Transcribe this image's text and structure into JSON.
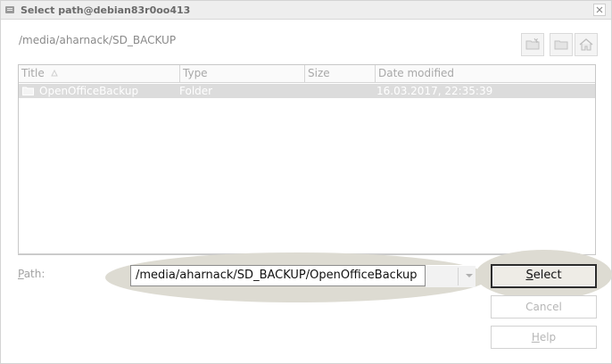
{
  "window": {
    "title": "Select path@debian83r0oo413",
    "current_path": "/media/aharnack/SD_BACKUP"
  },
  "toolbar": {
    "icons": [
      "new-folder-icon",
      "up-folder-icon",
      "home-icon"
    ]
  },
  "filelist": {
    "columns": [
      "Title",
      "Type",
      "Size",
      "Date modified"
    ],
    "rows": [
      {
        "title": "OpenOfficeBackup",
        "type": "Folder",
        "size": "",
        "date_modified": "16.03.2017, 22:35:39",
        "icon": "folder-icon"
      }
    ]
  },
  "path": {
    "label_first": "P",
    "label_rest": "ath:",
    "value": "/media/aharnack/SD_BACKUP/OpenOfficeBackup"
  },
  "buttons": {
    "select_first": "S",
    "select_rest": "elect",
    "cancel": "Cancel",
    "help_first": "H",
    "help_rest": "elp"
  },
  "colors": {
    "highlight_ellipse": "#dddbd2",
    "row_selected": "#dcdcdc"
  }
}
